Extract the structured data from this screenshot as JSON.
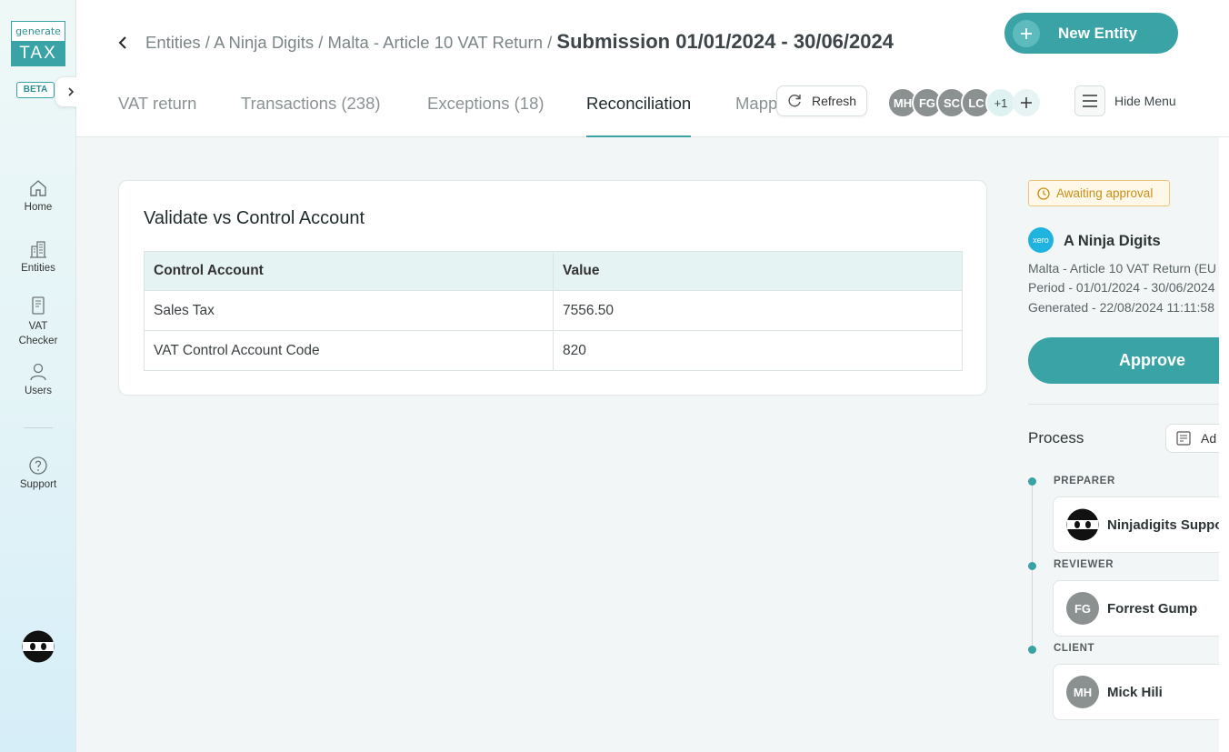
{
  "app": {
    "logo_top": "generate",
    "logo_bottom": "TAX",
    "beta_label": "BETA"
  },
  "sidebar": {
    "items": [
      {
        "label": "Home",
        "icon": "home-icon"
      },
      {
        "label": "Entities",
        "icon": "building-icon"
      },
      {
        "label": "VAT Checker",
        "icon": "document-icon"
      },
      {
        "label": "Users",
        "icon": "user-icon"
      },
      {
        "label": "Support",
        "icon": "help-icon"
      }
    ]
  },
  "header": {
    "breadcrumb": {
      "path": "Entities / A Ninja Digits / Malta - Article 10 VAT Return /",
      "current": "Submission 01/01/2024 - 30/06/2024"
    },
    "new_entity_label": "New Entity",
    "tabs": [
      {
        "label": "VAT return",
        "active": false
      },
      {
        "label": "Transactions (238)",
        "active": false
      },
      {
        "label": "Exceptions (18)",
        "active": false
      },
      {
        "label": "Reconciliation",
        "active": true
      },
      {
        "label": "Mapp",
        "active": false
      }
    ],
    "refresh_label": "Refresh",
    "avatars": [
      {
        "initials": "MH",
        "color": "#8a9190"
      },
      {
        "initials": "FG",
        "color": "#8a9190"
      },
      {
        "initials": "SC",
        "color": "#8a9190"
      },
      {
        "initials": "LC",
        "color": "#8a9190"
      }
    ],
    "more_count": "+1",
    "hide_menu_label": "Hide Menu"
  },
  "card": {
    "title": "Validate vs Control Account",
    "columns": [
      "Control Account",
      "Value"
    ],
    "rows": [
      [
        "Sales Tax",
        "7556.50"
      ],
      [
        "VAT Control Account Code",
        "820"
      ]
    ]
  },
  "right_panel": {
    "status": "Awaiting approval",
    "org_logo_text": "xero",
    "org_name": "A Ninja Digits",
    "return_type": "Malta - Article 10 VAT Return (EU",
    "period": "Period - 01/01/2024 - 30/06/2024",
    "generated": "Generated - 22/08/2024 11:11:58",
    "approve_label": "Approve",
    "process_title": "Process",
    "add_note_label": "Ad",
    "process": [
      {
        "role": "PREPARER",
        "name": "Ninjadigits Suppo",
        "initials": "",
        "avatar": "ninja"
      },
      {
        "role": "REVIEWER",
        "name": "Forrest Gump",
        "initials": "FG",
        "avatar": "initials"
      },
      {
        "role": "CLIENT",
        "name": "Mick Hili",
        "initials": "MH",
        "avatar": "initials"
      }
    ]
  },
  "colors": {
    "accent": "#3aa3a5",
    "status": "#c98f16",
    "avatar_gray": "#8a9190"
  }
}
